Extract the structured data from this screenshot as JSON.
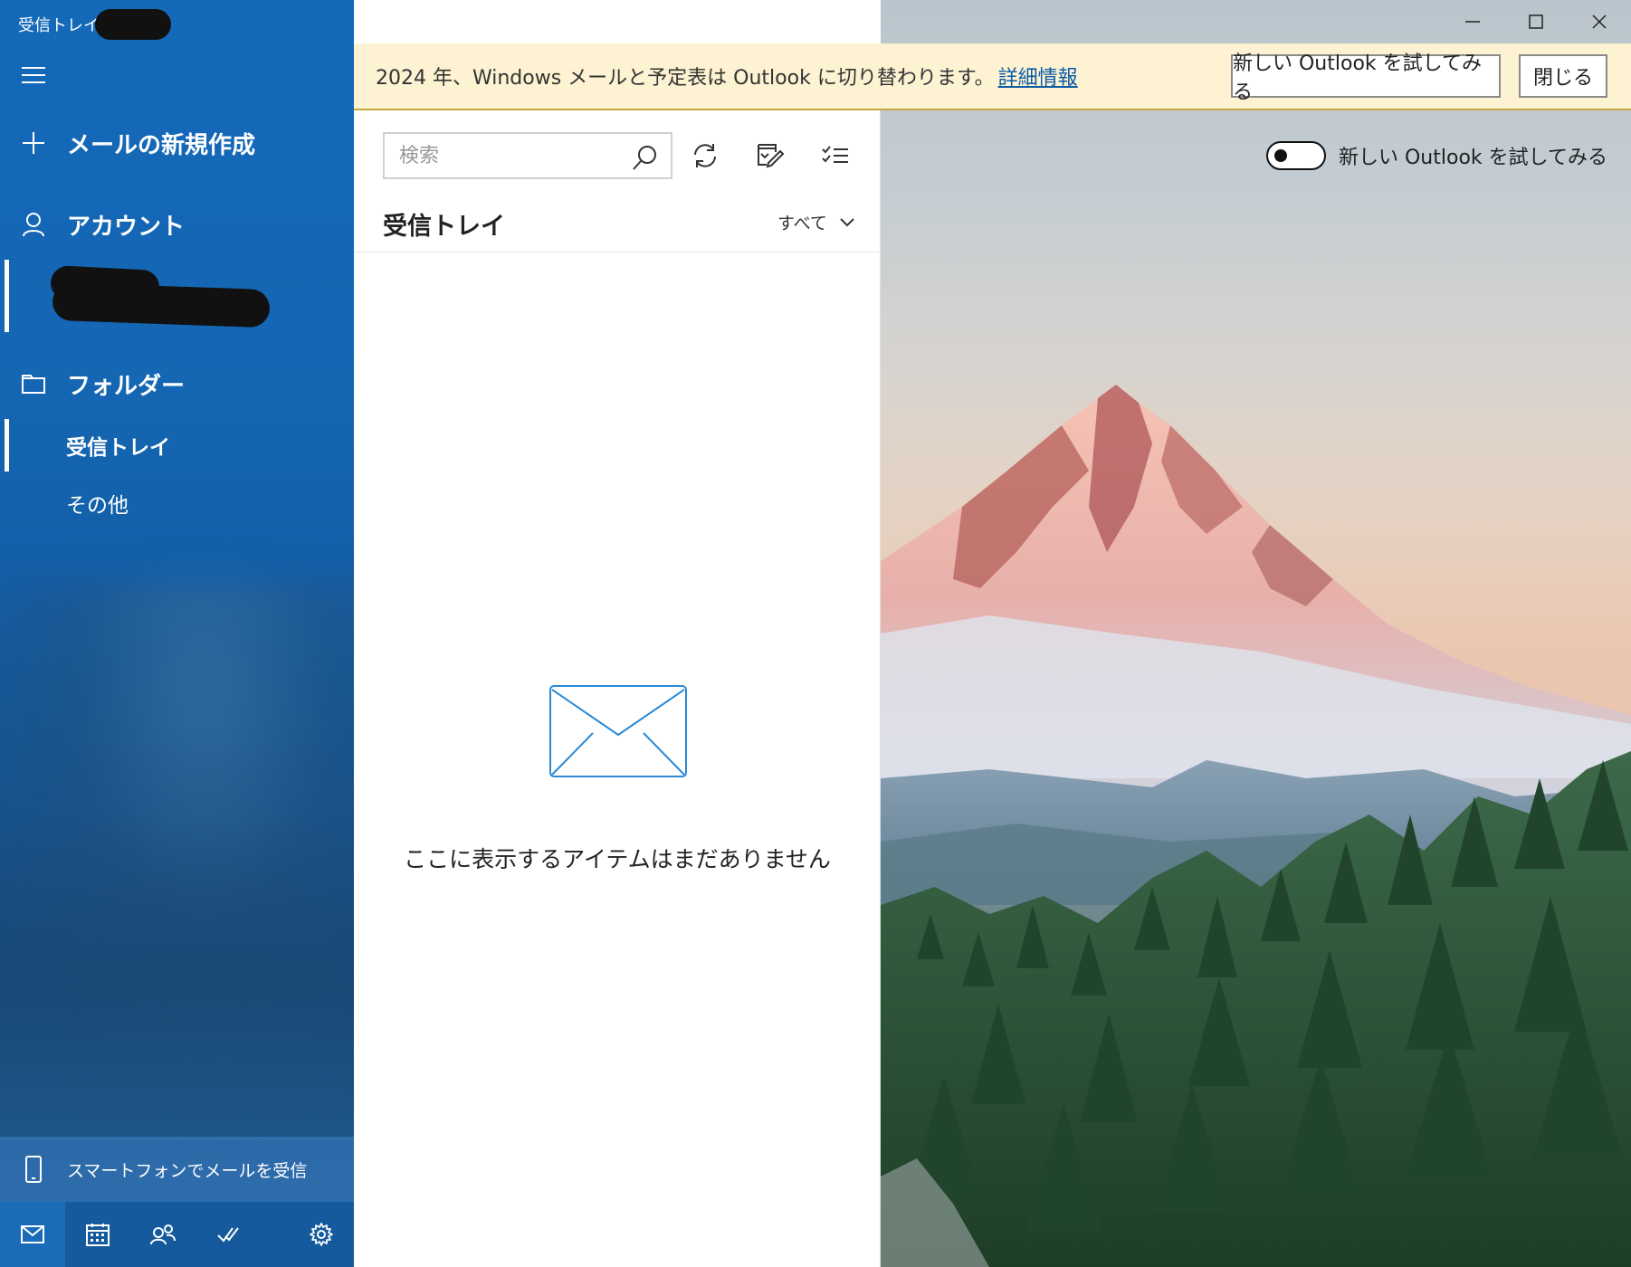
{
  "window": {
    "title": "受信トレイ",
    "controls": [
      "minimize",
      "maximize",
      "close"
    ]
  },
  "sidebar": {
    "new_mail_label": "メールの新規作成",
    "account_label": "アカウント",
    "folders_label": "フォルダー",
    "folders": [
      {
        "label": "受信トレイ",
        "selected": true
      },
      {
        "label": "その他",
        "selected": false
      }
    ],
    "phone_label": "スマートフォンでメールを受信",
    "bottom_nav": [
      "mail-icon",
      "calendar-icon",
      "people-icon",
      "todo-icon",
      "settings-icon"
    ],
    "accent": "#1469b9"
  },
  "banner": {
    "message": "2024 年、Windows メールと予定表は Outlook に切り替わります。",
    "link": "詳細情報",
    "try_button": "新しい Outlook を試してみる",
    "close_button": "閉じる",
    "background": "#fdf2d2"
  },
  "list": {
    "search_placeholder": "検索",
    "folder_title": "受信トレイ",
    "filter_label": "すべて",
    "empty_message": "ここに表示するアイテムはまだありません"
  },
  "toggle": {
    "label": "新しい Outlook を試してみる",
    "on": false
  }
}
